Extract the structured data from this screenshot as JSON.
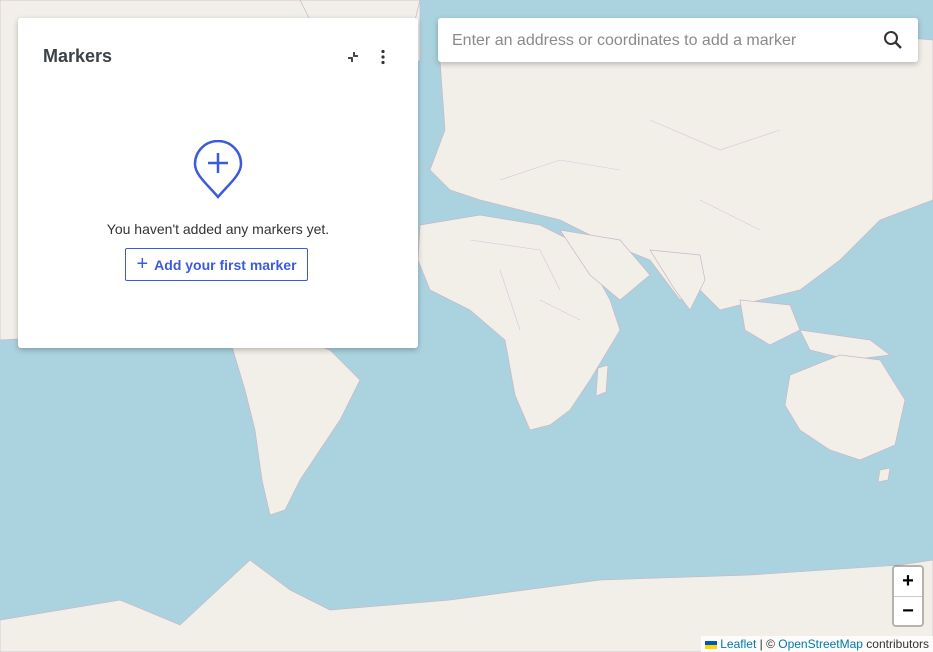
{
  "panel": {
    "title": "Markers",
    "empty_message": "You haven't added any markers yet.",
    "add_button_label": "Add your first marker",
    "add_button_icon": "plus-icon",
    "collapse_icon": "collapse-icon",
    "menu_icon": "more-vertical-icon",
    "empty_icon": "map-pin-plus-icon"
  },
  "search": {
    "placeholder": "Enter an address or coordinates to add a marker",
    "value": "",
    "icon": "search-icon"
  },
  "zoom": {
    "in_label": "+",
    "out_label": "−"
  },
  "attribution": {
    "leaflet_label": "Leaflet",
    "separator": " | © ",
    "osm_label": "OpenStreetMap",
    "suffix": " contributors"
  },
  "colors": {
    "accent": "#3b5bdb",
    "ocean": "#aad3df",
    "land": "#f2efe9"
  }
}
